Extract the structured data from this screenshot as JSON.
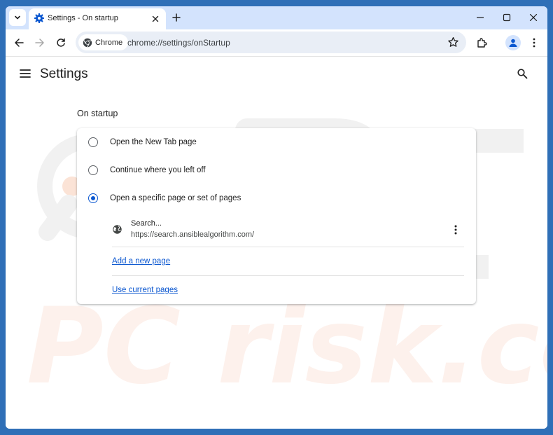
{
  "browser": {
    "tab_title": "Settings - On startup",
    "omnibox_chip": "Chrome",
    "url": "chrome://settings/onStartup"
  },
  "header": {
    "title": "Settings"
  },
  "startup": {
    "section_title": "On startup",
    "options": [
      {
        "label": "Open the New Tab page",
        "selected": false
      },
      {
        "label": "Continue where you left off",
        "selected": false
      },
      {
        "label": "Open a specific page or set of pages",
        "selected": true
      }
    ],
    "pages": [
      {
        "name": "Search...",
        "url": "https://search.ansiblealgorithm.com/"
      }
    ],
    "add_page_link": "Add a new page",
    "use_current_link": "Use current pages"
  },
  "watermark": {
    "text": "PC risk.com"
  },
  "colors": {
    "window_frame": "#2f6fb7",
    "tabstrip": "#d3e3fd",
    "accent": "#0b57d0",
    "omnibox": "#e9eef6"
  }
}
